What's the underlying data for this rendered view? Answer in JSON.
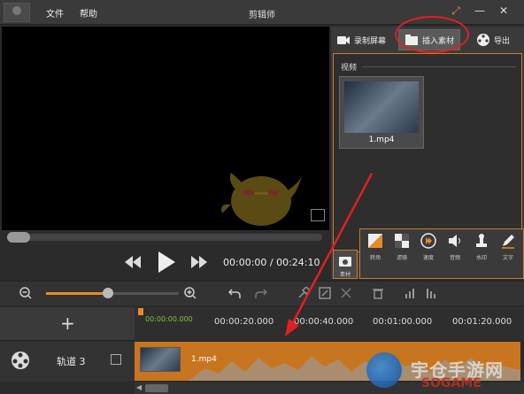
{
  "menu": {
    "file": "文件",
    "help": "帮助"
  },
  "app_title": "剪辑师",
  "window_controls": {
    "restore": "⤢",
    "minimize": "—",
    "close": "✕"
  },
  "player": {
    "time_readout": "00:00:00 / 00:24:10",
    "progress": 0.0
  },
  "tabs": [
    {
      "label": "录制屏幕",
      "icon": "camera-icon"
    },
    {
      "label": "插入素材",
      "icon": "folder-icon",
      "active": true
    },
    {
      "label": "导出",
      "icon": "film-reel-icon"
    }
  ],
  "media": {
    "section_label": "视频",
    "items": [
      {
        "name": "1.mp4"
      }
    ]
  },
  "side_tool": {
    "label": "素材"
  },
  "tools": [
    {
      "label": "转场",
      "icon": "transition-icon"
    },
    {
      "label": "滤镜",
      "icon": "filter-icon"
    },
    {
      "label": "速度",
      "icon": "speed-icon"
    },
    {
      "label": "音频",
      "icon": "audio-icon"
    },
    {
      "label": "水印",
      "icon": "watermark-icon"
    },
    {
      "label": "文字",
      "icon": "text-pen-icon"
    }
  ],
  "timeline": {
    "zoom_level": 0.45,
    "start_time": "00:00:00.000",
    "ticks": [
      "00:00:20.000",
      "00:00:40.000",
      "00:01:00.000",
      "00:01:20.000"
    ],
    "add_track_symbol": "+",
    "track": {
      "name": "轨道 3",
      "clip_name": "1.mp4"
    }
  },
  "watermark": {
    "text": "宇仓手游网",
    "sub": "SOGAME"
  },
  "colors": {
    "accent": "#c87a2c",
    "annotation": "#e02020",
    "timecode_green": "#7fc13c"
  }
}
